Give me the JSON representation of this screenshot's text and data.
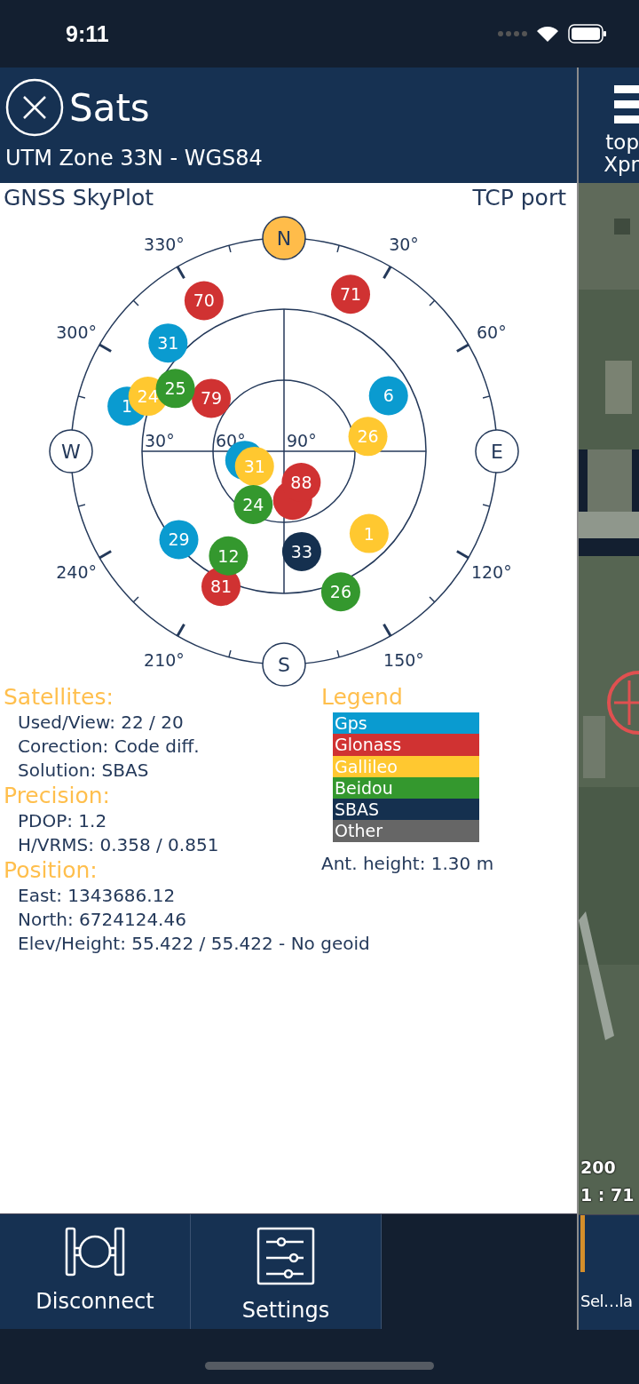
{
  "status_bar": {
    "time": "9:11"
  },
  "header": {
    "title": "Sats",
    "subtitle": "UTM Zone 33N - WGS84"
  },
  "panel": {
    "title": "GNSS SkyPlot",
    "source": "TCP port"
  },
  "skyplot": {
    "cardinals": [
      {
        "label": "N",
        "highlighted": true
      },
      {
        "label": "E",
        "highlighted": false
      },
      {
        "label": "S",
        "highlighted": false
      },
      {
        "label": "W",
        "highlighted": false
      }
    ],
    "azimuth_labels": [
      "30°",
      "60°",
      "120°",
      "150°",
      "210°",
      "240°",
      "300°",
      "330°"
    ],
    "ring_labels": [
      "30°",
      "60°",
      "90°"
    ],
    "satellites": [
      {
        "label": "31",
        "color": "#0a9bd0"
      },
      {
        "label": "1",
        "color": "#0a9bd0"
      },
      {
        "label": "6",
        "color": "#0a9bd0"
      },
      {
        "label": "29",
        "color": "#0a9bd0"
      },
      {
        "color": "#0a9bd0"
      },
      {
        "label": "70",
        "color": "#d03232"
      },
      {
        "label": "71",
        "color": "#d03232"
      },
      {
        "label": "79",
        "color": "#d03232"
      },
      {
        "color": "#d03232"
      },
      {
        "label": "88",
        "color": "#d03232"
      },
      {
        "label": "81",
        "color": "#d03232"
      },
      {
        "label": "24",
        "color": "#ffc830"
      },
      {
        "label": "26",
        "color": "#ffc830"
      },
      {
        "label": "31",
        "color": "#ffc830"
      },
      {
        "label": "1",
        "color": "#ffc830"
      },
      {
        "label": "25",
        "color": "#34982e"
      },
      {
        "label": "24",
        "color": "#34982e"
      },
      {
        "label": "12",
        "color": "#34982e"
      },
      {
        "label": "26",
        "color": "#34982e"
      },
      {
        "label": "33",
        "color": "#15304f"
      }
    ]
  },
  "info": [
    {
      "heading": "Satellites:",
      "lines": [
        "Used/View: 22 / 20",
        "Corection: Code diff.",
        "Solution: SBAS"
      ]
    },
    {
      "heading": "Precision:",
      "lines": [
        "PDOP: 1.2",
        "H/VRMS: 0.358 / 0.851"
      ]
    },
    {
      "heading": "Position:",
      "lines": [
        "East: 1343686.12",
        "North: 6724124.46",
        "Elev/Height: 55.422 / 55.422 - No geoid"
      ]
    }
  ],
  "legend": {
    "title": "Legend",
    "items": [
      {
        "label": "Gps",
        "color": "#0a9bd0"
      },
      {
        "label": "Glonass",
        "color": "#d03232"
      },
      {
        "label": "Gallileo",
        "color": "#ffc830"
      },
      {
        "label": "Beidou",
        "color": "#34982e"
      },
      {
        "label": "SBAS",
        "color": "#15304f"
      },
      {
        "label": "Other",
        "color": "#666666"
      }
    ],
    "note": "Ant. height: 1.30 m"
  },
  "toolbar": [
    {
      "label": "Disconnect",
      "kind": "disconnect"
    },
    {
      "label": "Settings",
      "kind": "settings"
    }
  ],
  "side_panel": {
    "menu_lines": [
      "top",
      "Xpr"
    ],
    "scale": "200",
    "ratio": "1 : 71",
    "footer": "Sel…la"
  }
}
